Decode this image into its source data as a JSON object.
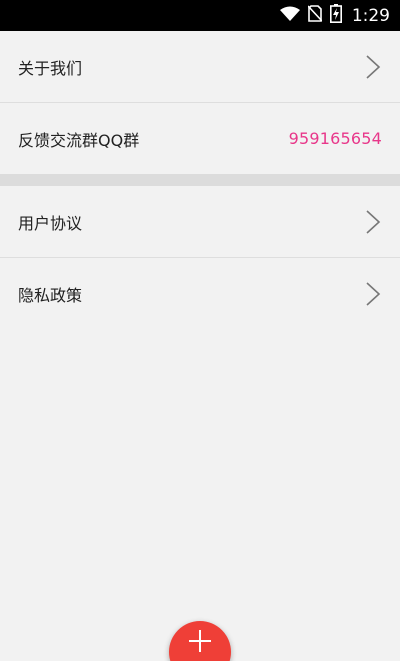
{
  "status_bar": {
    "time": "1:29",
    "icons": [
      "wifi-icon",
      "no-sim-icon",
      "battery-charging-icon"
    ]
  },
  "settings": {
    "section1": [
      {
        "label": "关于我们",
        "icon": "chevron-right-icon"
      },
      {
        "label": "反馈交流群QQ群",
        "value": "959165654"
      }
    ],
    "section2": [
      {
        "label": "用户协议",
        "icon": "chevron-right-icon"
      },
      {
        "label": "隐私政策",
        "icon": "chevron-right-icon"
      }
    ]
  },
  "fab": {
    "icon": "plus-icon"
  },
  "colors": {
    "accent_value": "#e8378a",
    "fab": "#ef3f37",
    "background": "#f2f2f2",
    "status_bar": "#000000"
  }
}
